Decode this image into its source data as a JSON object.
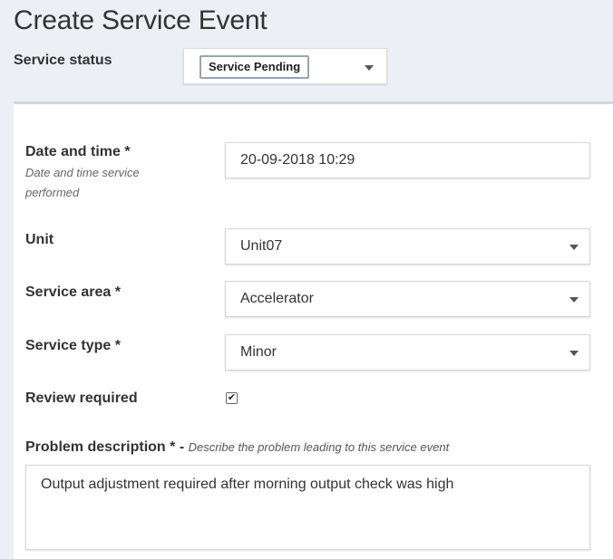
{
  "page": {
    "title": "Create Service Event"
  },
  "status": {
    "label": "Service status",
    "value": "Service Pending"
  },
  "form": {
    "datetime": {
      "label": "Date and time *",
      "help": "Date and time service performed",
      "value": "20-09-2018 10:29"
    },
    "unit": {
      "label": "Unit",
      "value": "Unit07"
    },
    "service_area": {
      "label": "Service area *",
      "value": "Accelerator"
    },
    "service_type": {
      "label": "Service type *",
      "value": "Minor"
    },
    "review_required": {
      "label": "Review required",
      "checked": true,
      "check_glyph": "✔"
    },
    "problem_description": {
      "label": "Problem description *",
      "separator": " - ",
      "hint": "Describe the problem leading to this service event",
      "value": "Output adjustment required after morning output check was high"
    }
  },
  "icons": {
    "dropdown": "chevron-down-icon",
    "checkbox": "checkmark-icon"
  }
}
